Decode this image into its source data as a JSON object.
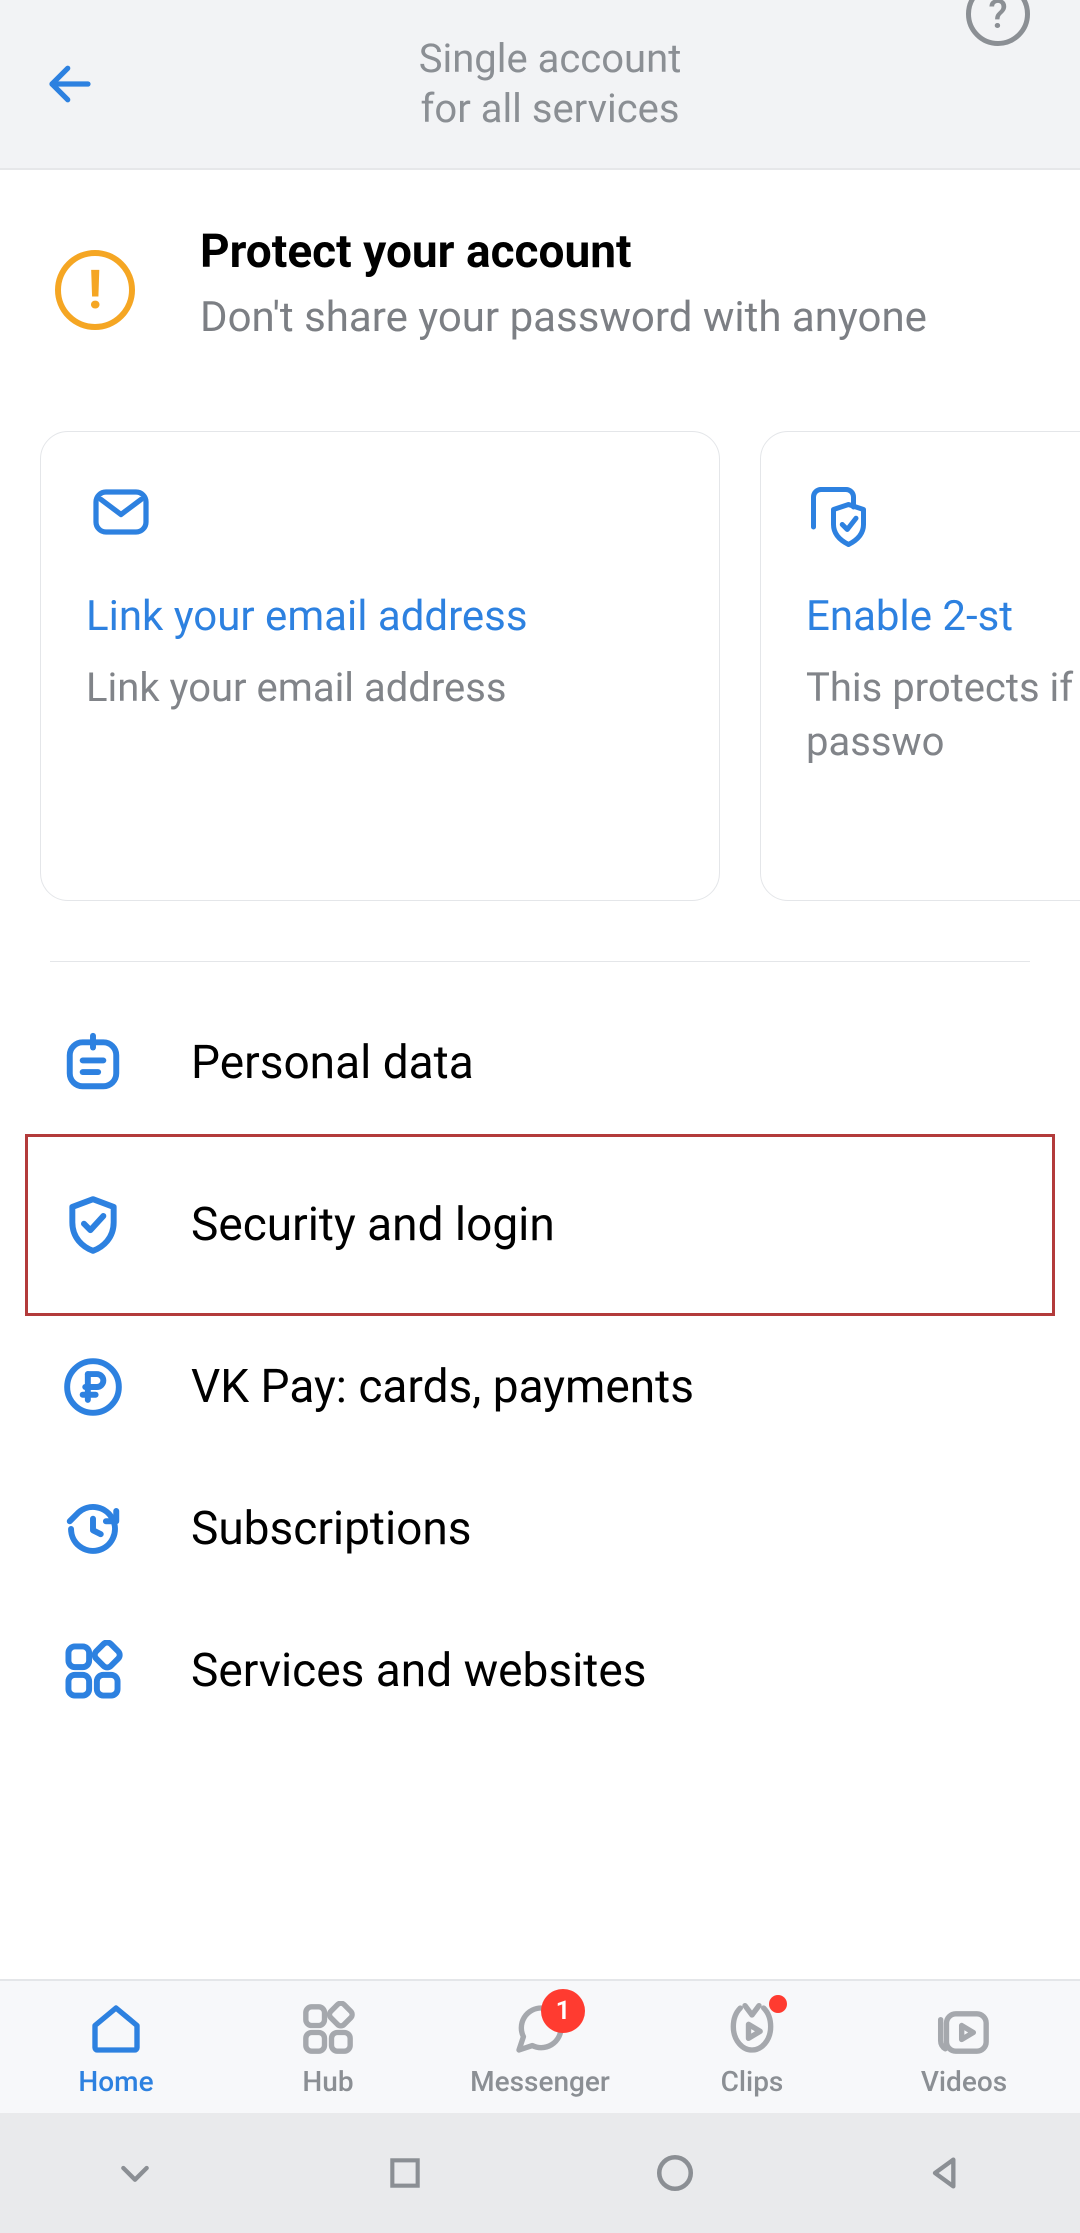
{
  "header": {
    "title_line1": "Single account",
    "title_line2": "for all services"
  },
  "protect": {
    "title": "Protect your account",
    "subtitle": "Don't share your password with anyone"
  },
  "cards": [
    {
      "title": "Link your email address",
      "subtitle": "Link your email address"
    },
    {
      "title": "Enable 2-st",
      "subtitle": "This protects if someone g your passwo"
    }
  ],
  "settings": [
    {
      "label": "Personal data",
      "icon": "personal"
    },
    {
      "label": "Security and login",
      "icon": "shield",
      "highlight": true
    },
    {
      "label": "VK Pay: cards, payments",
      "icon": "ruble"
    },
    {
      "label": "Subscriptions",
      "icon": "clock"
    },
    {
      "label": "Services and websites",
      "icon": "apps"
    }
  ],
  "bottom_nav": {
    "home": "Home",
    "hub": "Hub",
    "messenger": "Messenger",
    "messenger_badge": "1",
    "clips": "Clips",
    "videos": "Videos"
  }
}
